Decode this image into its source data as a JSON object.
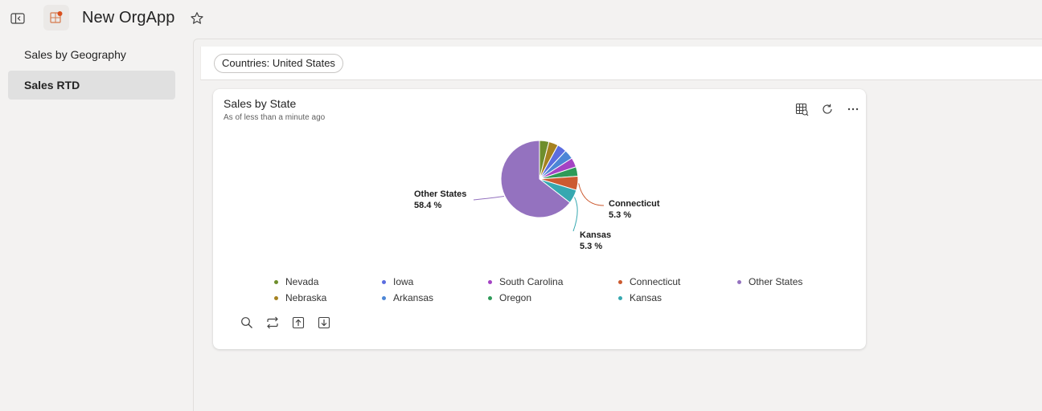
{
  "app": {
    "title": "New OrgApp"
  },
  "nav": {
    "items": [
      {
        "label": "Sales by Geography"
      },
      {
        "label": "Sales RTD"
      }
    ]
  },
  "filter": {
    "key": "Countries:",
    "value": "United States"
  },
  "card": {
    "title": "Sales by State",
    "subtitle": "As of less than a minute ago"
  },
  "icons": {
    "sidebar_toggle": "panel-left-icon",
    "app_logo": "app-logo-icon",
    "favorite": "star-icon",
    "table_view": "table-view-icon",
    "refresh": "refresh-icon",
    "more": "more-icon",
    "search": "search-icon",
    "swap": "swap-icon",
    "drill_up": "drill-up-icon",
    "drill_down": "drill-down-icon"
  },
  "chart_data": {
    "type": "pie",
    "title": "Sales by State",
    "categories": [
      "Nevada",
      "Nebraska",
      "Iowa",
      "Arkansas",
      "South Carolina",
      "Oregon",
      "Connecticut",
      "Kansas",
      "Other States"
    ],
    "values": [
      3.6,
      3.6,
      3.6,
      3.6,
      3.6,
      3.6,
      5.3,
      5.3,
      58.4
    ],
    "colors": [
      "#6e8e2c",
      "#a58220",
      "#5b6de0",
      "#4c86d6",
      "#a443c4",
      "#2e9a58",
      "#cc5a30",
      "#36a8b0",
      "#9472bf"
    ],
    "data_labels": [
      {
        "category": "Other States",
        "text": "58.4 %"
      },
      {
        "category": "Connecticut",
        "text": "5.3 %"
      },
      {
        "category": "Kansas",
        "text": "5.3 %"
      }
    ],
    "legend": "bottom"
  }
}
